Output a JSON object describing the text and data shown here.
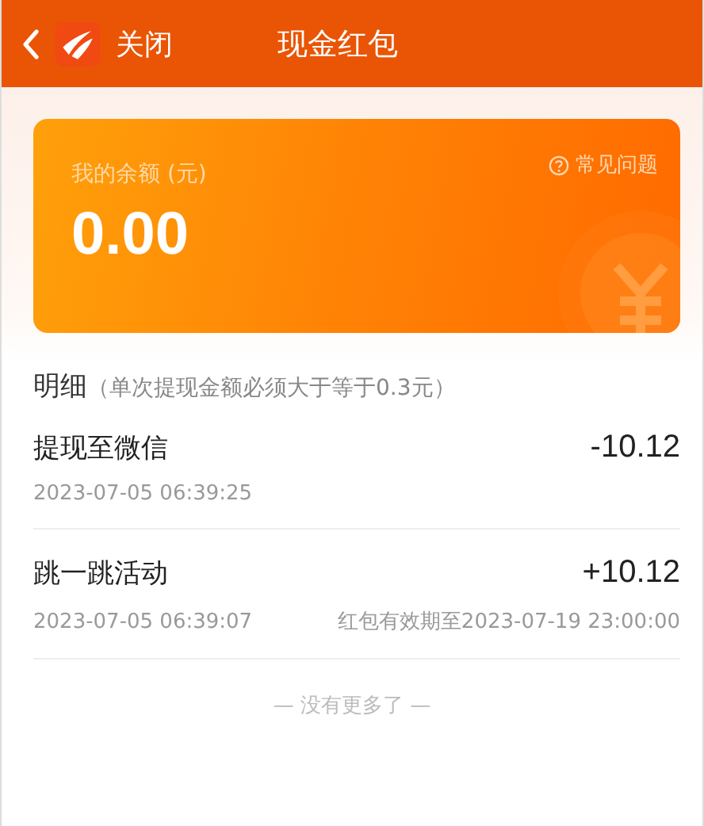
{
  "header": {
    "close_label": "关闭",
    "title": "现金红包"
  },
  "balance_card": {
    "label": "我的余额 (元)",
    "amount": "0.00",
    "faq_link": "常见问题"
  },
  "details": {
    "heading": "明细",
    "note": "（单次提现金额必须大于等于0.3元）",
    "records": [
      {
        "title": "提现至微信",
        "amount": "-10.12",
        "time": "2023-07-05 06:39:25"
      },
      {
        "title": "跳一跳活动",
        "amount": "+10.12",
        "time": "2023-07-05 06:39:07",
        "expiry": "红包有效期至2023-07-19 23:00:00"
      }
    ]
  },
  "footer": "— 没有更多了 —"
}
